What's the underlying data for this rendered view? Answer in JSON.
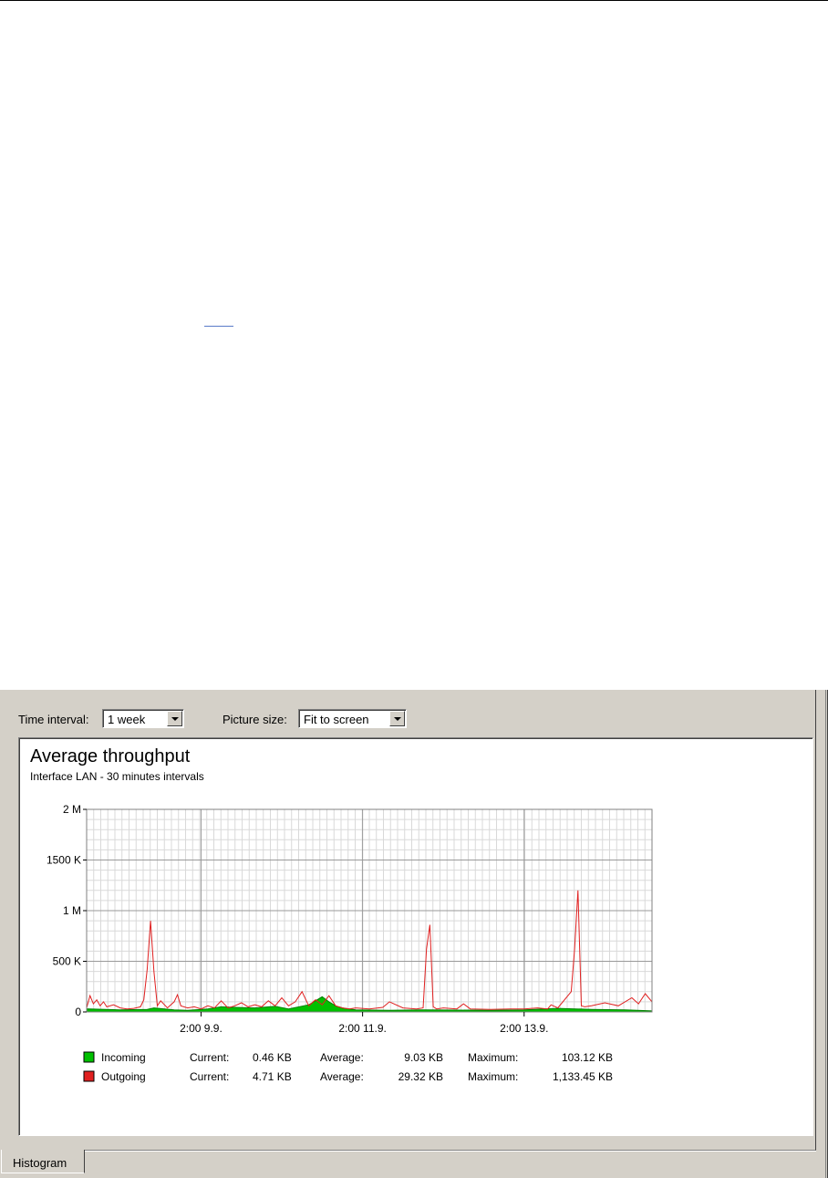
{
  "toolbar": {
    "time_interval_label": "Time interval:",
    "time_interval_value": "1 week",
    "picture_size_label": "Picture size:",
    "picture_size_value": "Fit to screen"
  },
  "tabs": [
    {
      "label": "Histogram",
      "active": true
    }
  ],
  "colors": {
    "incoming": "#00c000",
    "outgoing": "#e02020",
    "grid_major": "#9a9a9a",
    "grid_minor": "#d9d9d9"
  },
  "legend": [
    {
      "name": "Incoming",
      "current_label": "Current:",
      "current": "0.46 KB",
      "average_label": "Average:",
      "average": "9.03 KB",
      "maximum_label": "Maximum:",
      "maximum": "103.12 KB"
    },
    {
      "name": "Outgoing",
      "current_label": "Current:",
      "current": "4.71 KB",
      "average_label": "Average:",
      "average": "29.32 KB",
      "maximum_label": "Maximum:",
      "maximum": "1,133.45 KB"
    }
  ],
  "chart_data": {
    "type": "area",
    "title": "Average throughput",
    "subtitle": "Interface LAN - 30 minutes intervals",
    "ylim": [
      0,
      2000
    ],
    "yunit": "K",
    "yticks": [
      {
        "v": 0,
        "label": "0"
      },
      {
        "v": 500,
        "label": "500 K"
      },
      {
        "v": 1000,
        "label": "1 M"
      },
      {
        "v": 1500,
        "label": "1500 K"
      },
      {
        "v": 2000,
        "label": "2 M"
      }
    ],
    "xlim": [
      0,
      168
    ],
    "xticks": [
      {
        "v": 34,
        "label": "2:00 9.9."
      },
      {
        "v": 82,
        "label": "2:00 11.9."
      },
      {
        "v": 130,
        "label": "2:00 13.9."
      }
    ],
    "grid": true,
    "series": [
      {
        "name": "Incoming",
        "x": [
          0,
          10,
          18,
          20,
          26,
          30,
          36,
          40,
          44,
          50,
          56,
          60,
          66,
          68,
          70,
          72,
          74,
          76,
          80,
          90,
          100,
          110,
          120,
          130,
          140,
          150,
          160,
          168
        ],
        "values": [
          30,
          20,
          25,
          40,
          20,
          15,
          30,
          50,
          45,
          40,
          55,
          30,
          70,
          110,
          150,
          100,
          60,
          40,
          20,
          15,
          20,
          18,
          15,
          20,
          35,
          25,
          20,
          10
        ]
      },
      {
        "name": "Outgoing",
        "x": [
          0,
          1,
          2,
          3,
          4,
          5,
          6,
          8,
          10,
          12,
          14,
          16,
          17,
          18,
          19,
          20,
          21,
          22,
          24,
          26,
          27,
          28,
          30,
          32,
          34,
          36,
          38,
          40,
          42,
          44,
          46,
          48,
          50,
          52,
          54,
          56,
          58,
          60,
          62,
          64,
          66,
          68,
          70,
          72,
          74,
          76,
          78,
          80,
          84,
          88,
          90,
          94,
          98,
          100,
          101,
          102,
          103,
          104,
          106,
          110,
          112,
          114,
          120,
          126,
          130,
          134,
          137,
          138,
          140,
          144,
          145,
          146,
          147,
          148,
          150,
          154,
          158,
          162,
          164,
          166,
          168
        ],
        "values": [
          40,
          160,
          80,
          120,
          60,
          100,
          50,
          70,
          40,
          30,
          35,
          50,
          120,
          420,
          900,
          400,
          60,
          110,
          40,
          100,
          170,
          60,
          40,
          50,
          30,
          60,
          40,
          110,
          40,
          60,
          90,
          50,
          70,
          50,
          110,
          60,
          140,
          60,
          100,
          200,
          60,
          120,
          70,
          160,
          60,
          40,
          30,
          40,
          30,
          45,
          100,
          40,
          30,
          40,
          620,
          860,
          50,
          30,
          40,
          30,
          80,
          30,
          25,
          30,
          30,
          40,
          30,
          70,
          40,
          200,
          620,
          1200,
          60,
          50,
          60,
          90,
          60,
          140,
          80,
          180,
          100
        ]
      }
    ]
  }
}
